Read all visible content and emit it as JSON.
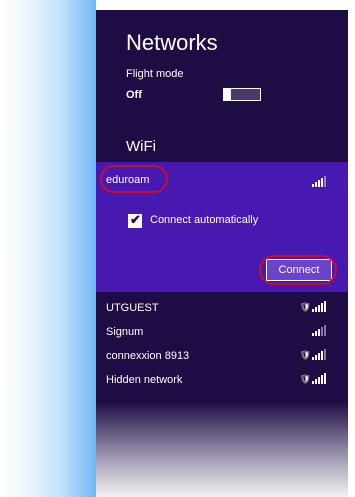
{
  "panel": {
    "title": "Networks",
    "flight_mode": {
      "label": "Flight mode",
      "state": "Off"
    },
    "section_label": "WiFi",
    "selected_network": {
      "name": "eduroam",
      "auto_connect_label": "Connect automatically",
      "auto_connect_checked": true,
      "connect_label": "Connect"
    },
    "networks": [
      {
        "name": "UTGUEST",
        "secured": true
      },
      {
        "name": "Signum",
        "secured": false
      },
      {
        "name": "connexxion 8913",
        "secured": true
      },
      {
        "name": "Hidden network",
        "secured": true
      }
    ]
  },
  "colors": {
    "panel_bg": "#1f0c44",
    "selected_bg": "#4719b0",
    "button_bg": "#6a45cc",
    "annotation": "#c8102e"
  },
  "icons": {
    "signal": "wifi-signal-icon",
    "secured_signal": "secured-wifi-signal-icon",
    "checkmark": "checkmark-icon"
  }
}
